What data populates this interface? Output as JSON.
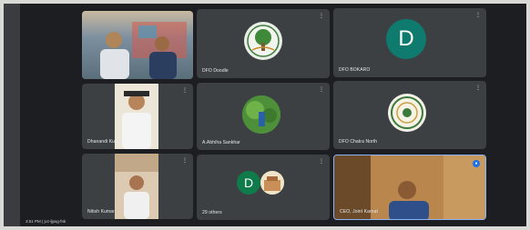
{
  "meeting": {
    "time": "3:51 PM",
    "separator": "|",
    "meeting_code": "jvz-ljpsg-fnk"
  },
  "tiles": [
    {
      "name": "",
      "kind": "video"
    },
    {
      "name": "DFO Doodle",
      "kind": "logo"
    },
    {
      "name": "DFO BOKARO",
      "kind": "letter",
      "letter": "D",
      "color": "#0f7a6e"
    },
    {
      "name": "Dhanandi Kumar",
      "kind": "video"
    },
    {
      "name": "A.Abhiha Sankhar",
      "kind": "logo"
    },
    {
      "name": "DFO Chatra North",
      "kind": "logo"
    },
    {
      "name": "Nitish Kumar",
      "kind": "video"
    },
    {
      "name": "29 others",
      "kind": "group",
      "letter": "D",
      "color": "#0f7a4a"
    },
    {
      "name": "CEO, Joint Karnat",
      "kind": "video"
    }
  ],
  "colors": {
    "tile_bg": "#3c4043",
    "screen_bg": "#1c1e21",
    "active_speaker_border": "#8ab4f8"
  }
}
